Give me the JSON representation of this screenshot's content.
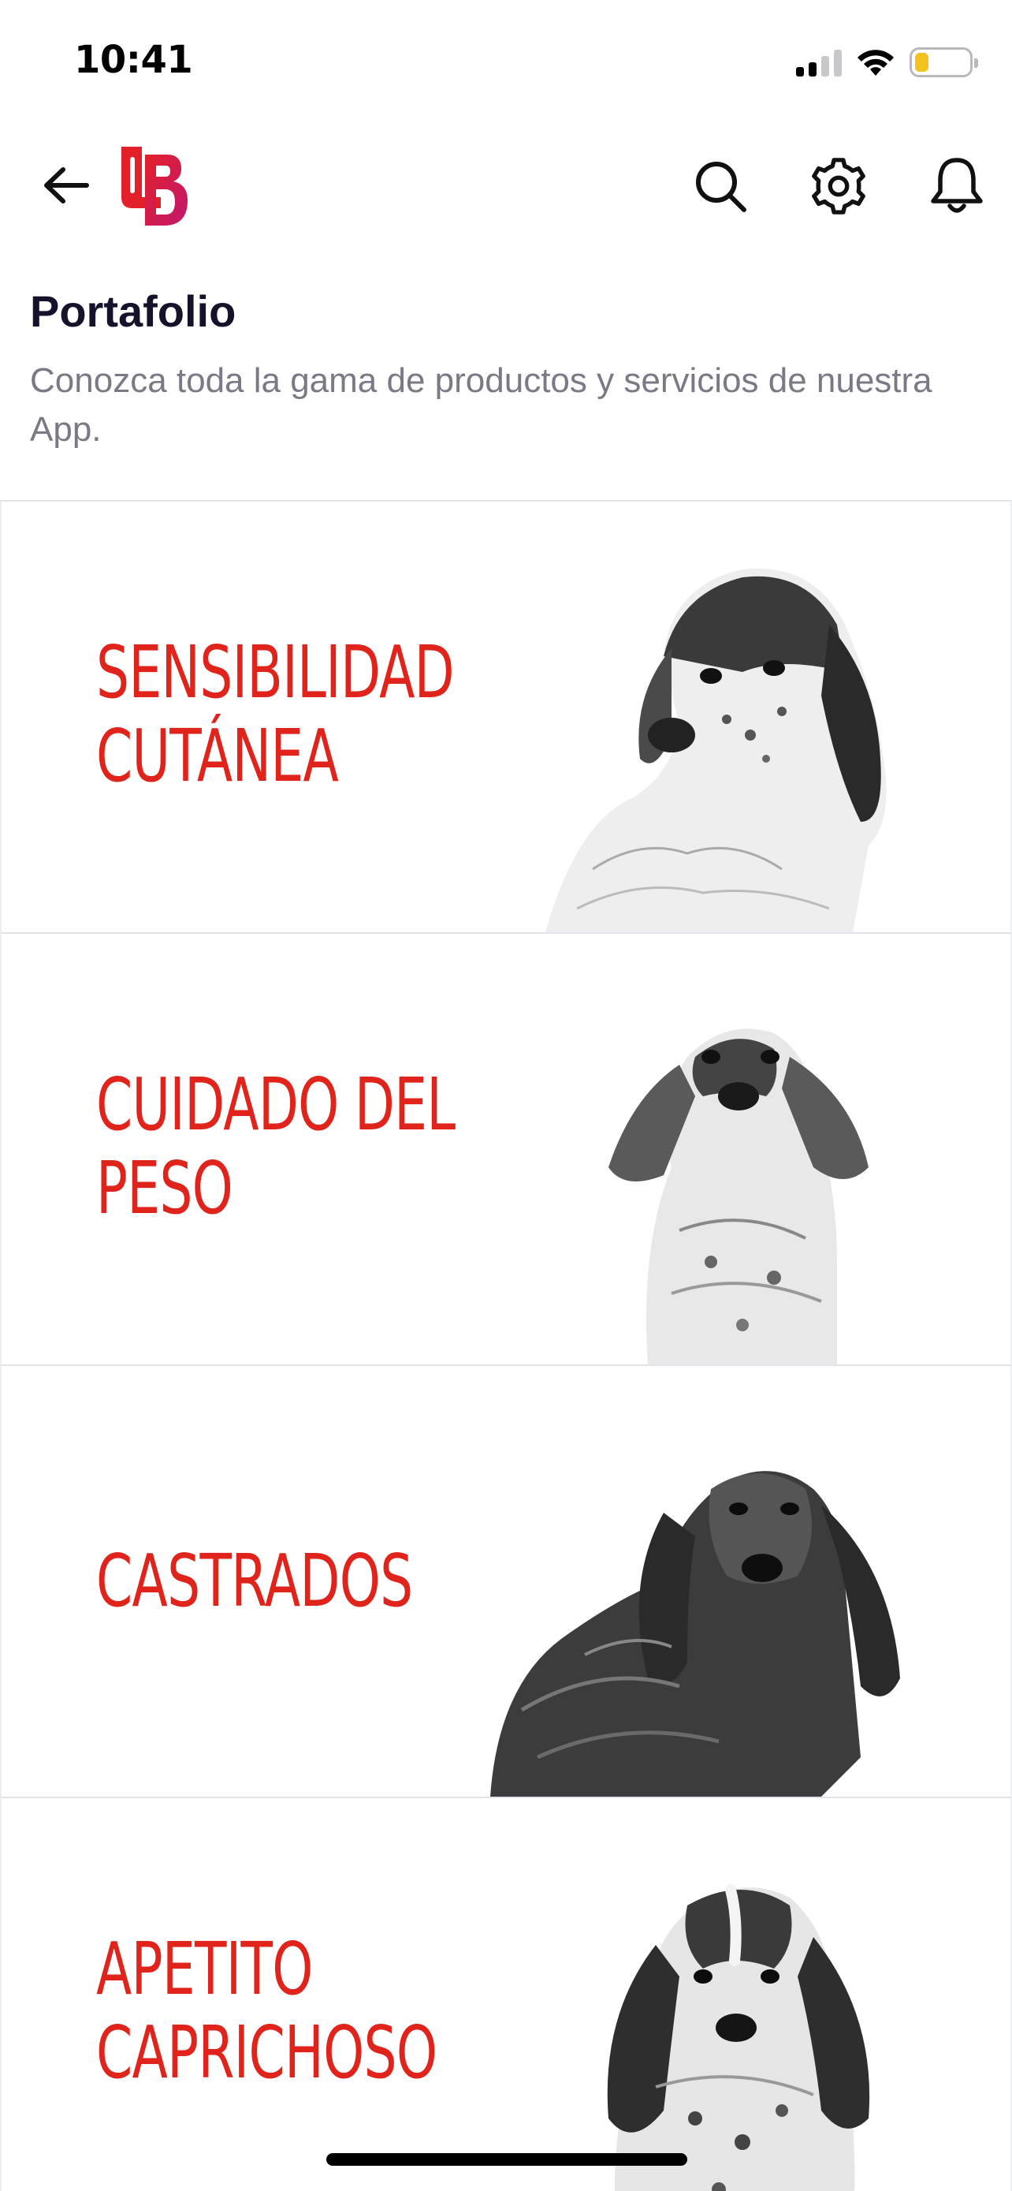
{
  "status_bar": {
    "time": "10:41",
    "signal_bars": 2,
    "battery_level": 0.25,
    "battery_color": "#f2c31d"
  },
  "header": {
    "back_icon": "arrow-left-icon",
    "logo": "brand-logo",
    "actions": [
      {
        "icon": "search-icon"
      },
      {
        "icon": "gear-icon"
      },
      {
        "icon": "bell-icon"
      }
    ]
  },
  "page": {
    "title": "Portafolio",
    "subtitle": "Conozca toda la gama de productos y servicios de nuestra App."
  },
  "colors": {
    "accent": "#e0241c",
    "title": "#15132b",
    "subtitle": "#7a7a86",
    "logo_gradient": [
      "#e3202a",
      "#c2186e"
    ]
  },
  "cards": [
    {
      "title": "SENSIBILIDAD\nCUTÁNEA",
      "image": "english-setter-dog"
    },
    {
      "title": "CUIDADO DEL\nPESO",
      "image": "dachshund-dog"
    },
    {
      "title": "CASTRADOS",
      "image": "long-haired-dachshund-dog"
    },
    {
      "title": "APETITO\nCAPRICHOSO",
      "image": "cocker-spaniel-dog"
    }
  ]
}
